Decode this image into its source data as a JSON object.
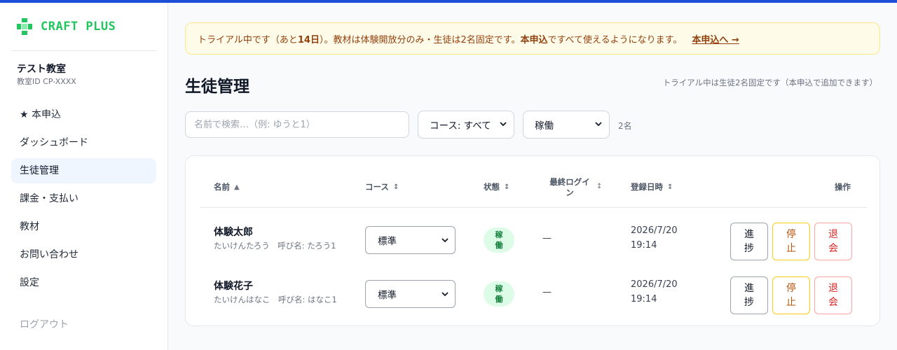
{
  "colors": {
    "topbar": "#1d4ed8",
    "brand": "#22c55e",
    "warning_bg": "#fefce8",
    "warning_text": "#92400e",
    "active_nav": "#eff6ff",
    "badge_bg": "#dcfce7",
    "badge_text": "#15803d"
  },
  "sidebar": {
    "logo_text": "CRAFT PLUS",
    "logo_icon": "plus-cross-icon",
    "school_name": "テスト教室",
    "school_id": "教室ID CP-XXXX",
    "items": [
      {
        "label": "★ 本申込"
      },
      {
        "label": "ダッシュボード"
      },
      {
        "label": "生徒管理",
        "active": true
      },
      {
        "label": "課金・支払い"
      },
      {
        "label": "教材"
      },
      {
        "label": "お問い合わせ"
      },
      {
        "label": "設定"
      }
    ],
    "logout": "ログアウト"
  },
  "trial": {
    "part1": "トライアル中です（あと ",
    "days": "14日",
    "part2": "）。教材は体験開放分のみ・生徒は2名固定です。",
    "bold": "本申込",
    "part3": "ですべて使えるようになります。",
    "link": "本申込へ →"
  },
  "page": {
    "title": "生徒管理",
    "note": "トライアル中は生徒2名固定です（本申込で追加できます）"
  },
  "filters": {
    "search_placeholder": "名前で検索…（例: ゆうと1）",
    "course_value": "コース: すべて",
    "status_value": "稼働",
    "count": "2名"
  },
  "table": {
    "headers": {
      "name": "名前",
      "name_sort": "▲",
      "course": "コース",
      "status": "状態",
      "last_login": "最終ログイン",
      "registered": "登録日時",
      "actions": "操作",
      "sort": "↕"
    },
    "rows": [
      {
        "name": "体験太郎",
        "kana": "たいけんたろう　呼び名: たろう1",
        "course": "標準",
        "status": "稼働",
        "last_login": "—",
        "date": "2026/7/20",
        "time": "19:14",
        "btn_progress": "進捗",
        "btn_stop": "停止",
        "btn_quit": "退会"
      },
      {
        "name": "体験花子",
        "kana": "たいけんはなこ　呼び名: はなこ1",
        "course": "標準",
        "status": "稼働",
        "last_login": "—",
        "date": "2026/7/20",
        "time": "19:14",
        "btn_progress": "進捗",
        "btn_stop": "停止",
        "btn_quit": "退会"
      }
    ]
  }
}
